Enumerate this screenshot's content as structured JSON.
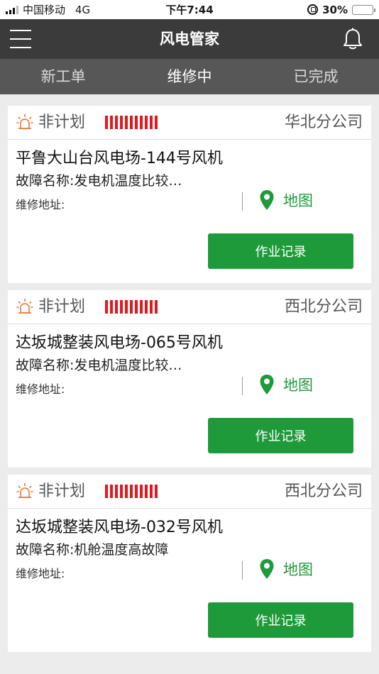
{
  "status_bar": {
    "carrier": "中国移动",
    "network": "4G",
    "time": "下午7:44",
    "battery_percent": "30%",
    "battery_level": 0.3
  },
  "header": {
    "title": "风电管家",
    "menu_icon": "hamburger-menu-icon",
    "bell_icon": "bell-icon"
  },
  "tabs": [
    {
      "label": "新工单",
      "active": false
    },
    {
      "label": "维修中",
      "active": true
    },
    {
      "label": "已完成",
      "active": false
    }
  ],
  "colors": {
    "accent_green": "#1f9a3a",
    "alarm_orange": "#e8834a",
    "priority_red": "#e3181f",
    "header_bg": "#3b3b3b",
    "tab_bg": "#575757"
  },
  "orders": [
    {
      "plan_type": "非计划",
      "priority_level": 11,
      "company": "华北分公司",
      "site": "平鲁大山台风电场-144号风机",
      "fault": "故障名称:发电机温度比较…",
      "address_label": "维修地址:",
      "map_label": "地图",
      "action_label": "作业记录"
    },
    {
      "plan_type": "非计划",
      "priority_level": 11,
      "company": "西北分公司",
      "site": "达坂城整装风电场-065号风机",
      "fault": "故障名称:发电机温度比较…",
      "address_label": "维修地址:",
      "map_label": "地图",
      "action_label": "作业记录"
    },
    {
      "plan_type": "非计划",
      "priority_level": 11,
      "company": "西北分公司",
      "site": "达坂城整装风电场-032号风机",
      "fault": "故障名称:机舱温度高故障",
      "address_label": "维修地址:",
      "map_label": "地图",
      "action_label": "作业记录"
    }
  ]
}
